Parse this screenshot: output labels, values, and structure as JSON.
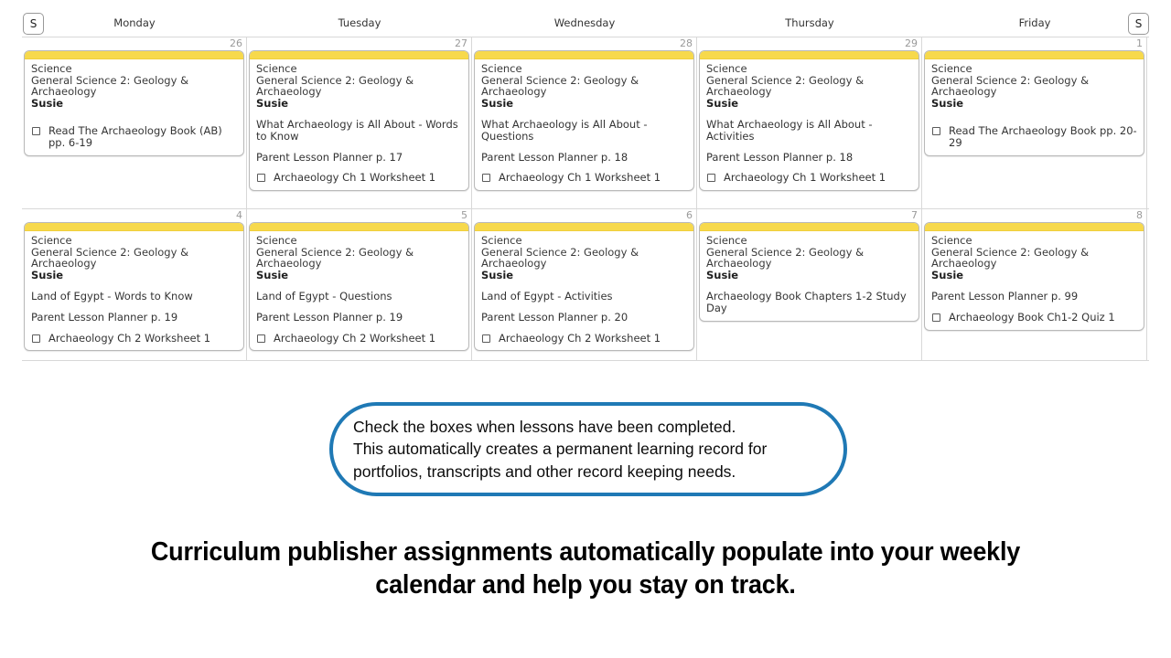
{
  "calendar": {
    "weekend_toggle_left_label": "S",
    "weekend_toggle_right_label": "S",
    "day_names": [
      "Monday",
      "Tuesday",
      "Wednesday",
      "Thursday",
      "Friday"
    ],
    "rows": [
      {
        "cells": [
          {
            "date": "26",
            "subject": "Science",
            "course": "General Science 2: Geology & Archaeology",
            "student": "Susie",
            "assignments": [],
            "todos": [
              "Read The Archaeology Book (AB) pp. 6-19"
            ]
          },
          {
            "date": "27",
            "subject": "Science",
            "course": "General Science 2: Geology & Archaeology",
            "student": "Susie",
            "assignments": [
              "What Archaeology is All About - Words to Know",
              "Parent Lesson Planner p. 17"
            ],
            "todos": [
              "Archaeology Ch 1 Worksheet 1"
            ]
          },
          {
            "date": "28",
            "subject": "Science",
            "course": "General Science 2: Geology & Archaeology",
            "student": "Susie",
            "assignments": [
              "What Archaeology is All About - Questions",
              "Parent Lesson Planner p. 18"
            ],
            "todos": [
              "Archaeology Ch 1 Worksheet 1"
            ]
          },
          {
            "date": "29",
            "subject": "Science",
            "course": "General Science 2: Geology & Archaeology",
            "student": "Susie",
            "assignments": [
              "What Archaeology is All About - Activities",
              "Parent Lesson Planner p. 18"
            ],
            "todos": [
              "Archaeology Ch 1 Worksheet 1"
            ]
          },
          {
            "date": "1",
            "subject": "Science",
            "course": "General Science 2: Geology & Archaeology",
            "student": "Susie",
            "assignments": [],
            "todos": [
              "Read The Archaeology Book pp. 20-29"
            ]
          }
        ]
      },
      {
        "cells": [
          {
            "date": "4",
            "subject": "Science",
            "course": "General Science 2: Geology & Archaeology",
            "student": "Susie",
            "assignments": [
              "Land of Egypt - Words to Know",
              "Parent Lesson Planner p. 19"
            ],
            "todos": [
              "Archaeology Ch 2 Worksheet 1"
            ]
          },
          {
            "date": "5",
            "subject": "Science",
            "course": "General Science 2: Geology & Archaeology",
            "student": "Susie",
            "assignments": [
              "Land of Egypt - Questions",
              "Parent Lesson Planner p. 19"
            ],
            "todos": [
              "Archaeology Ch 2 Worksheet 1"
            ]
          },
          {
            "date": "6",
            "subject": "Science",
            "course": "General Science 2: Geology & Archaeology",
            "student": "Susie",
            "assignments": [
              "Land of Egypt - Activities",
              "Parent Lesson Planner p. 20"
            ],
            "todos": [
              "Archaeology Ch 2 Worksheet 1"
            ]
          },
          {
            "date": "7",
            "subject": "Science",
            "course": "General Science 2: Geology & Archaeology",
            "student": "Susie",
            "assignments": [
              "Archaeology Book Chapters 1-2 Study Day"
            ],
            "todos": []
          },
          {
            "date": "8",
            "subject": "Science",
            "course": "General Science 2: Geology & Archaeology",
            "student": "Susie",
            "assignments": [
              "Parent Lesson Planner p. 99"
            ],
            "todos": [
              "Archaeology Book Ch1-2 Quiz 1"
            ]
          }
        ]
      }
    ]
  },
  "callout": {
    "text": "Check the boxes when lessons have been completed.\nThis automatically creates a permanent learning record for\nportfolios, transcripts and other record keeping needs."
  },
  "headline": {
    "text": "Curriculum publisher assignments automatically populate into your weekly calendar and help you stay on track."
  },
  "colors": {
    "card_accent": "#f7d94c",
    "callout_border": "#1f79b5",
    "grid_line": "#d8d8d8",
    "date_number": "#9a9a9a"
  }
}
